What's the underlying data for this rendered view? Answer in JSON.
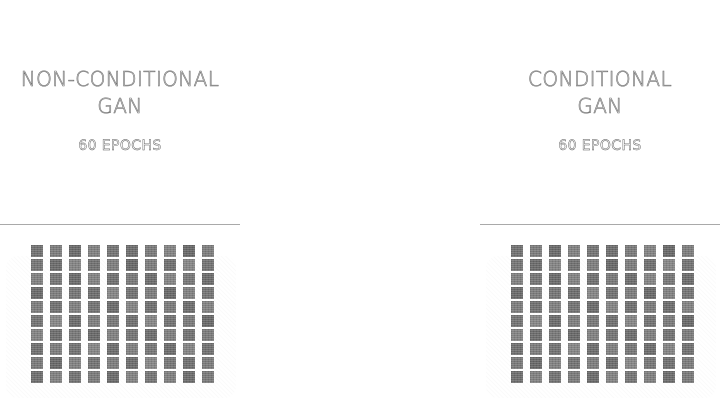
{
  "panels": [
    {
      "title_line1": "NON-CONDITIONAL",
      "title_line2": "GAN",
      "epochs_label": "60 EPOCHS"
    },
    {
      "title_line1": "CONDITIONAL",
      "title_line2": "GAN",
      "epochs_label": "60 EPOCHS"
    }
  ],
  "sample_grid": {
    "rows": 10,
    "cols": 10,
    "cell_shades": [
      "#6f6f6f",
      "#7a7a7a",
      "#686868",
      "#7f7f7f",
      "#727272",
      "#6c6c6c",
      "#787878",
      "#818181",
      "#666666",
      "#7c7c7c",
      "#747474",
      "#6a6a6a",
      "#838383",
      "#707070",
      "#7d7d7d",
      "#676767",
      "#7b7b7b",
      "#6e6e6e",
      "#858585",
      "#717171",
      "#7e7e7e",
      "#737373",
      "#696969",
      "#808080",
      "#6d6d6d",
      "#777777",
      "#6b6b6b",
      "#828282",
      "#757575",
      "#6a6a6a",
      "#686868",
      "#7c7c7c",
      "#747474",
      "#6c6c6c",
      "#848484",
      "#707070",
      "#7a7a7a",
      "#676767",
      "#7f7f7f",
      "#737373",
      "#7b7b7b",
      "#6f6f6f",
      "#7e7e7e",
      "#717171",
      "#696969",
      "#828282",
      "#6d6d6d",
      "#797979",
      "#6b6b6b",
      "#808080",
      "#727272",
      "#858585",
      "#6a6a6a",
      "#7c7c7c",
      "#767676",
      "#6e6e6e",
      "#838383",
      "#707070",
      "#787878",
      "#666666",
      "#818181",
      "#6c6c6c",
      "#777777",
      "#686868",
      "#7f7f7f",
      "#737373",
      "#6b6b6b",
      "#7d7d7d",
      "#717171",
      "#7a7a7a",
      "#6d6d6d",
      "#7b7b7b",
      "#707070",
      "#848484",
      "#6a6a6a",
      "#7e7e7e",
      "#747474",
      "#696969",
      "#828282",
      "#6f6f6f",
      "#787878",
      "#676767",
      "#808080",
      "#727272",
      "#7c7c7c",
      "#6b6b6b",
      "#858585",
      "#757575",
      "#6e6e6e",
      "#7a7a7a",
      "#6c6c6c",
      "#7f7f7f",
      "#717171",
      "#797979",
      "#686868",
      "#818181",
      "#737373",
      "#7d7d7d",
      "#6a6a6a",
      "#777777"
    ]
  }
}
